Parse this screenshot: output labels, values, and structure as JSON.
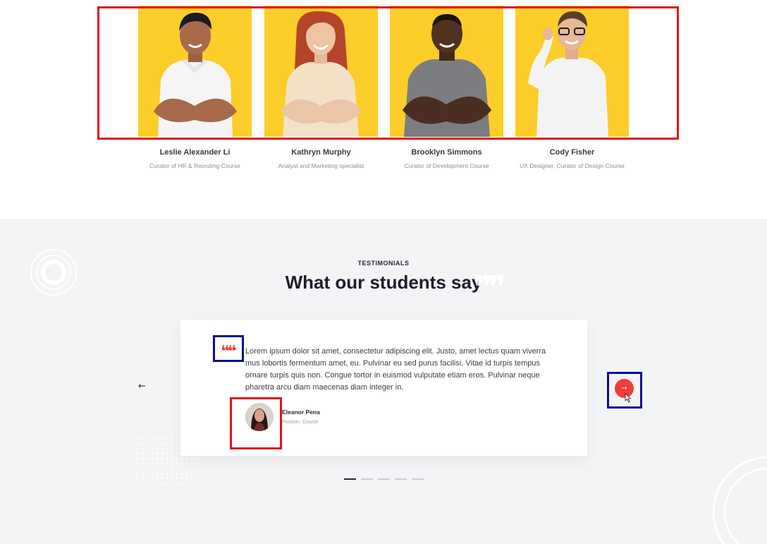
{
  "team": {
    "members": [
      {
        "name": "Leslie Alexander Li",
        "role": "Curator of HR & Recruting Course"
      },
      {
        "name": "Kathryn Murphy",
        "role": "Analyst and Marketing specialist"
      },
      {
        "name": "Brooklyn Simmons",
        "role": "Curator of Development Course"
      },
      {
        "name": "Cody Fisher",
        "role": "UX Designer, Curator of Design Course"
      }
    ],
    "photo_bg": "#fdcd2a"
  },
  "testimonials": {
    "eyebrow": "TESTIMONIALS",
    "heading": "What our students say",
    "quote_icon": "quote-icon",
    "quote": "Lorem ipsum dolor sit amet, consectetur adipiscing elit. Justo, amet lectus quam viverra mus lobortis fermentum amet, eu. Pulvinar eu sed purus facilisi. Vitae id turpis tempus ornare turpis quis non. Congue tortor in euismod vulputate etiam eros. Pulvinar neque pharetra arcu diam maecenas diam integer in.",
    "author": {
      "name": "Eleanor Pena",
      "position": "Position, Course"
    },
    "prev_icon": "←",
    "next_icon": "→",
    "slides": 5,
    "active_slide": 1,
    "accent": "#f23b3b"
  }
}
